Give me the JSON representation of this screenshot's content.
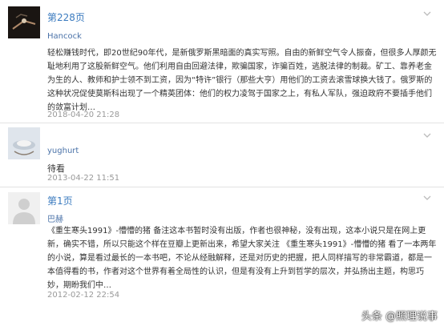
{
  "comments": [
    {
      "page_link": "第228页",
      "author": "Hancock",
      "body": "轻松赚钱时代，即20世纪90年代，是新俄罗斯黑暗面的真实写照。自由的新鲜空气令人振奋，但很多人厚颜无耻地利用了这股新鲜空气。他们利用自由回避法律，欺骗国家，诈骗百姓，逃脱法律的制裁。矿工、靠养老金为生的人、教师和护士领不到工资，因为“特许”银行（那些大亨）用他们的工资去滚雪球换大钱了。俄罗斯的这种状况促使莫斯科出现了一个精英团体：他们的权力凌驾于国家之上，有私人军队，强迫政府不要插手他们的敛富计划…",
      "time": "2018-04-20 21:28"
    },
    {
      "author": "yughurt",
      "body": "待看",
      "time": "2013-04-22 11:51"
    },
    {
      "page_link": "第1页",
      "author": "巴赫",
      "body": "《重生寒头1991》-懵懵的猪 备注这本书暂时没有出版，作者也很神秘，没有出现，这本小说只是在网上更新，确实不错，所以只能这个样在豆瓣上更新出来，希望大家关注 《重生寒头1991》-懵懵的猪 看了一本两年的小说，算是看过最长的一本书吧，不论从经融解释，还是对历史的把握，把人同样描写的非常霸道，都是一本值得看的书，作者对这个世界有着全局性的认识，但是有没有上升到哲学的层次，并弘扬出主题，构思巧妙，期盼我们中…",
      "time": "2012-02-12 22:54"
    }
  ],
  "watermark": "头条 @照理说事",
  "colors": {
    "link": "#3b7bbf",
    "author": "#4a72a8",
    "time": "#999999",
    "text": "#333333",
    "divider": "#e2e2e2"
  },
  "icons": {
    "collapse": "chevron-down-icon",
    "avatar_default": "user-placeholder-icon"
  }
}
